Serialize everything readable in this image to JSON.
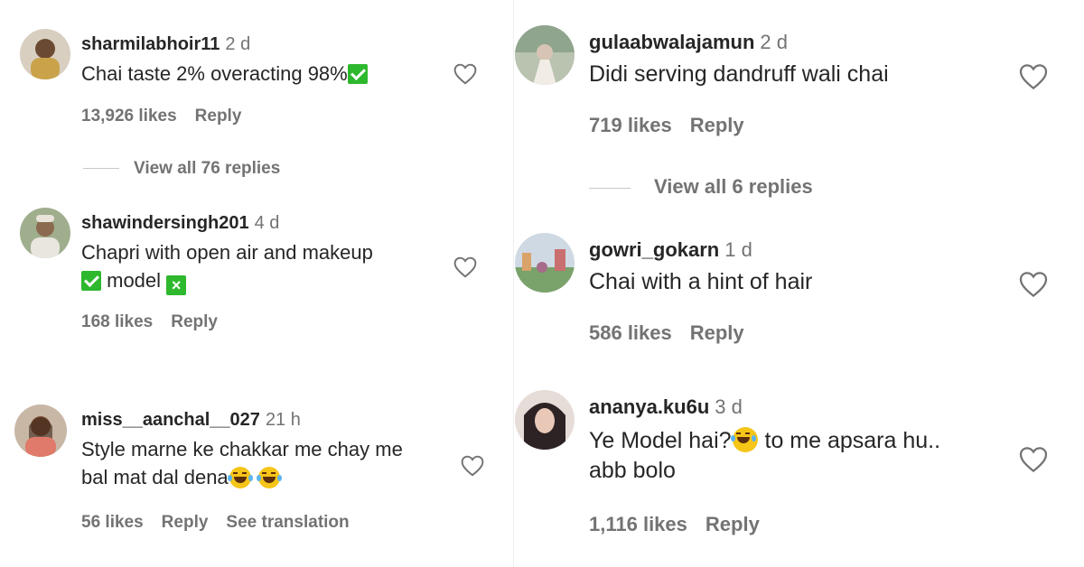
{
  "left_comments": [
    {
      "username": "sharmilabhoir11",
      "time": "2 d",
      "text_line1": "Chai taste 2% overacting 98%",
      "text_line2": "",
      "likes": "13,926 likes",
      "reply": "Reply",
      "view_replies": "View all 76 replies"
    },
    {
      "username": "shawindersingh201",
      "time": "4 d",
      "text_line1": "Chapri with open air and makeup",
      "text_line2": "model",
      "likes": "168 likes",
      "reply": "Reply",
      "view_replies": ""
    },
    {
      "username": "miss__aanchal__027",
      "time": "21 h",
      "text_line1": "Style marne ke chakkar me chay me",
      "text_line2": "bal mat dal dena",
      "likes": "56 likes",
      "reply": "Reply",
      "see_translation": "See translation"
    }
  ],
  "right_comments": [
    {
      "username": "gulaabwalajamun",
      "time": "2 d",
      "text_line1": "Didi serving dandruff wali chai",
      "likes": "719 likes",
      "reply": "Reply",
      "view_replies": "View all 6 replies"
    },
    {
      "username": "gowri_gokarn",
      "time": "1 d",
      "text_line1": "Chai with a hint of hair",
      "likes": "586 likes",
      "reply": "Reply"
    },
    {
      "username": "ananya.ku6u",
      "time": "3 d",
      "text_line1a": "Ye Model hai?",
      "text_line1b": " to me apsara hu..",
      "text_line2": "abb bolo",
      "likes": "1,116 likes",
      "reply": "Reply"
    }
  ],
  "icons": {
    "like": "heart-outline-icon",
    "check": "green-check-emoji",
    "cross": "green-cross-emoji",
    "laugh": "tears-of-joy-emoji"
  },
  "colors": {
    "text": "#262626",
    "muted": "#737373",
    "emoji_green": "#2eb82e"
  }
}
